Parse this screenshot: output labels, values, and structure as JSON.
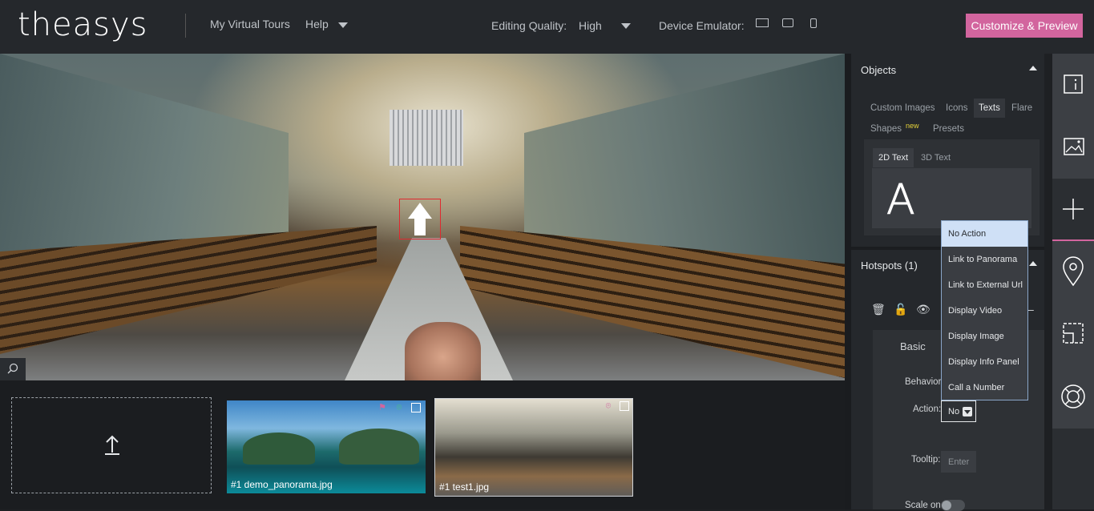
{
  "header": {
    "logo": "theasys",
    "nav_tours": "My Virtual Tours",
    "nav_help": "Help",
    "quality_label": "Editing Quality:",
    "quality_value": "High",
    "device_label": "Device Emulator:",
    "cta": "Customize & Preview",
    "cta_color": "#d2659e"
  },
  "panorama": {
    "hotspot_icon": "arrow-up-icon",
    "zoom_icon": "search-icon"
  },
  "filmstrip": {
    "upload_icon": "upload-icon",
    "thumbs": [
      {
        "label": "#1  demo_panorama.jpg",
        "icons": [
          "flag-icon",
          "map-pin-icon",
          "document-icon"
        ]
      },
      {
        "label": "#1  test1.jpg",
        "icons": [
          "map-pin-icon",
          "document-icon"
        ]
      }
    ]
  },
  "objects": {
    "title": "Objects",
    "tabs": [
      "Custom Images",
      "Icons",
      "Texts",
      "Flare",
      "Shapes",
      "Presets"
    ],
    "active_tab": "Texts",
    "new_badge": "new",
    "sub_tabs": [
      "2D Text",
      "3D Text"
    ],
    "preview_glyph": "A"
  },
  "hotspots": {
    "title": "Hotspots (1)",
    "section": "Basic",
    "behavior_label": "Behavior",
    "action_label": "Action:",
    "action_value": "No",
    "tooltip_label": "Tooltip:",
    "tooltip_placeholder": "Enter",
    "scale_label": "Scale on"
  },
  "action_dropdown": {
    "options": [
      "No Action",
      "Link to Panorama",
      "Link to External Url",
      "Display Video",
      "Display Image",
      "Display Info Panel",
      "Call a Number"
    ],
    "selected": "No Action"
  },
  "rail": [
    "info-icon",
    "image-icon",
    "plus-icon",
    "map-pin-icon",
    "floorplan-icon",
    "lifebuoy-icon"
  ]
}
